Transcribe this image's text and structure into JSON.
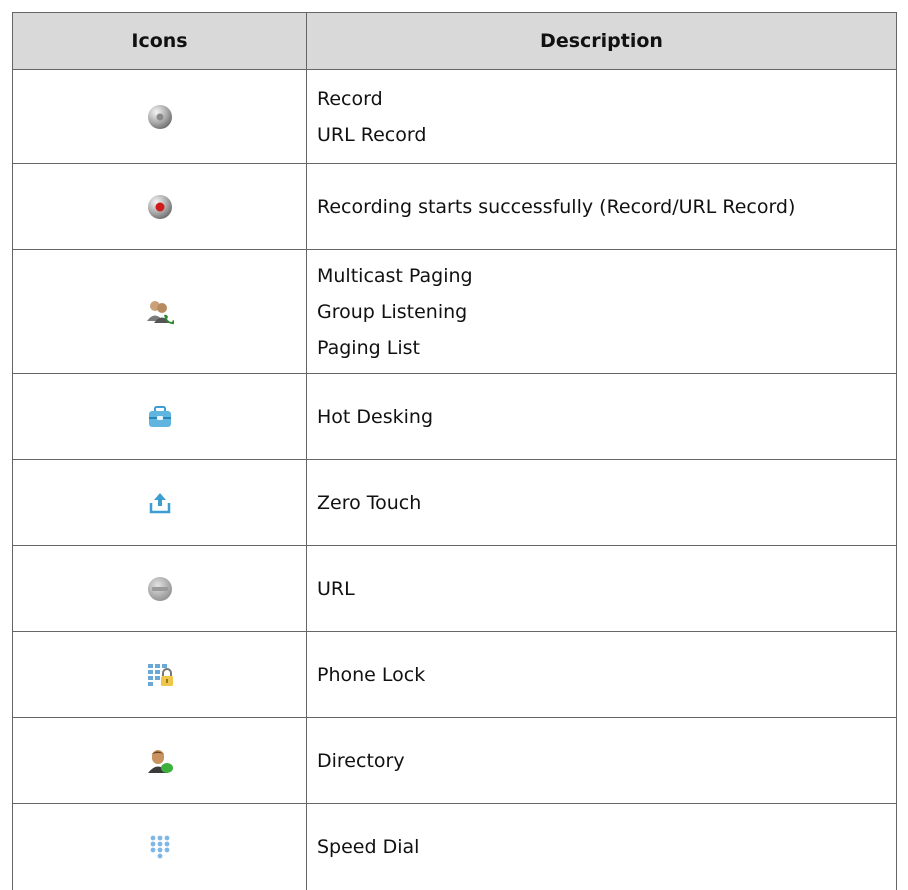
{
  "table": {
    "headers": {
      "icons": "Icons",
      "description": "Description"
    },
    "rows": [
      {
        "icon": "record-icon",
        "lines": [
          "Record",
          "URL Record"
        ]
      },
      {
        "icon": "recording-active-icon",
        "lines": [
          "Recording starts successfully (Record/URL Record)"
        ]
      },
      {
        "icon": "multicast-paging-icon",
        "lines": [
          "Multicast Paging",
          "Group Listening",
          "Paging List"
        ]
      },
      {
        "icon": "hot-desking-icon",
        "lines": [
          "Hot Desking"
        ]
      },
      {
        "icon": "zero-touch-icon",
        "lines": [
          "Zero Touch"
        ]
      },
      {
        "icon": "url-icon",
        "lines": [
          "URL"
        ]
      },
      {
        "icon": "phone-lock-icon",
        "lines": [
          "Phone Lock"
        ]
      },
      {
        "icon": "directory-icon",
        "lines": [
          "Directory"
        ]
      },
      {
        "icon": "speed-dial-icon",
        "lines": [
          "Speed Dial"
        ]
      }
    ]
  }
}
